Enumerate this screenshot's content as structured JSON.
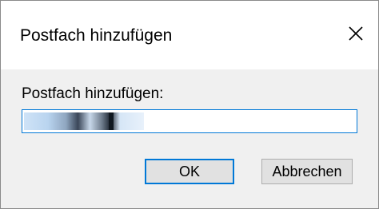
{
  "dialog": {
    "title": "Postfach hinzufügen",
    "close_icon": "close-icon",
    "prompt_label": "Postfach hinzufügen:",
    "input": {
      "value": "",
      "value_obscured": true,
      "focused": true
    },
    "buttons": {
      "ok_label": "OK",
      "cancel_label": "Abbrechen"
    }
  },
  "colors": {
    "accent": "#0078d7",
    "titlebar_bg": "#ffffff",
    "dialog_bg": "#f0f0f0",
    "button_bg": "#e1e1e1"
  }
}
